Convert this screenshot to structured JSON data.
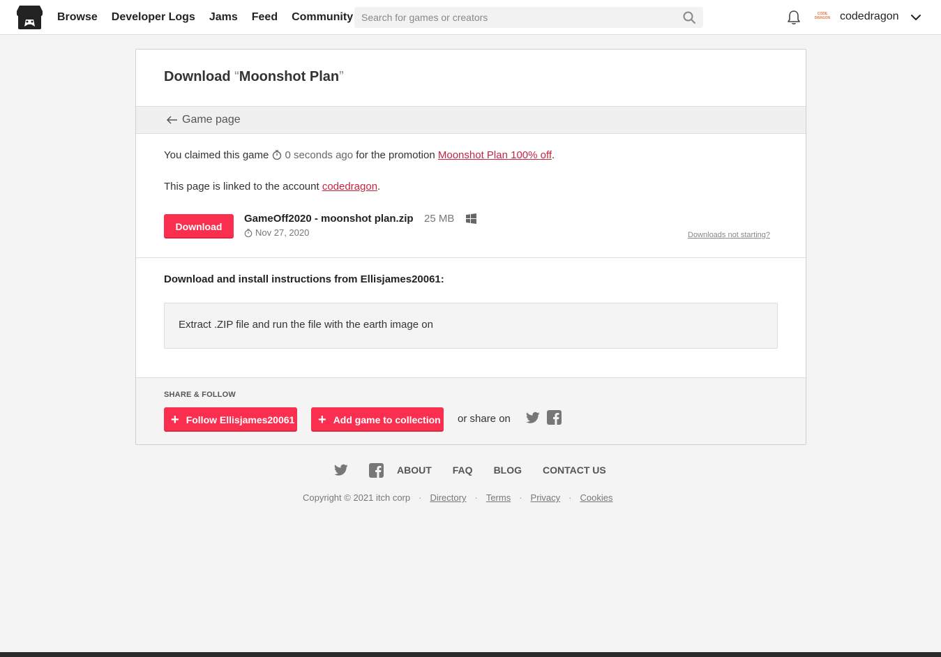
{
  "header": {
    "nav": [
      "Browse",
      "Developer Logs",
      "Jams",
      "Feed",
      "Community"
    ],
    "search_placeholder": "Search for games or creators",
    "avatar_text": "CODE DRAGON",
    "user_name": "codedragon"
  },
  "card": {
    "title_prefix": "Download",
    "quote_open": "“",
    "game_name": "Moonshot Plan",
    "quote_close": "”",
    "back_label": "Game page",
    "claim": {
      "prefix": "You claimed this game",
      "time": "0 seconds ago",
      "middle": "for the promotion",
      "promo_link": "Moonshot Plan 100% off",
      "suffix": "."
    },
    "linked": {
      "prefix": "This page is linked to the account",
      "account": "codedragon",
      "suffix": "."
    },
    "download_button": "Download",
    "file": {
      "name": "GameOff2020 - moonshot plan.zip",
      "size": "25 MB",
      "date": "Nov 27, 2020",
      "platform_icon": "windows-icon"
    },
    "downloads_not_starting": "Downloads not starting?",
    "instructions_title": "Download and install instructions from Ellisjames20061:",
    "instructions_text": "Extract .ZIP file and run the file with the earth image on",
    "share": {
      "title": "SHARE & FOLLOW",
      "follow_button": "Follow Ellisjames20061",
      "collection_button": "Add game to collection",
      "share_on": "or share on"
    }
  },
  "footer": {
    "links": [
      "ABOUT",
      "FAQ",
      "BLOG",
      "CONTACT US"
    ],
    "copyright": "Copyright © 2021 itch corp",
    "legal": [
      "Directory",
      "Terms",
      "Privacy",
      "Cookies"
    ],
    "separator": "·"
  },
  "colors": {
    "accent": "#fa2e4f",
    "link": "#c6243f",
    "background": "#f4f4f4"
  }
}
